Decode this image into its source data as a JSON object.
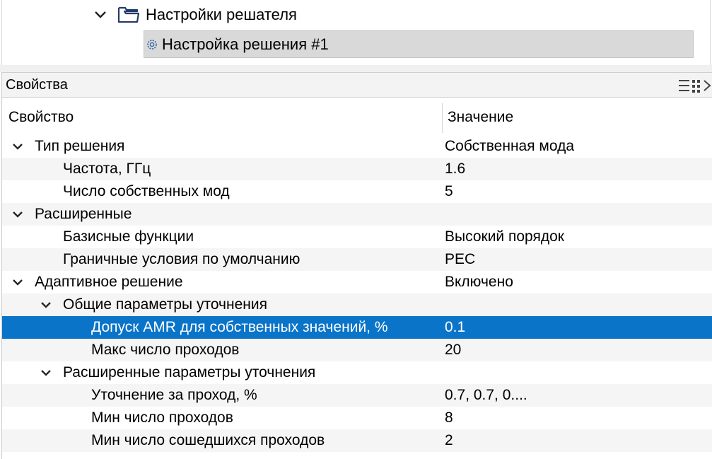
{
  "tree": {
    "folder_label": "Настройки решателя",
    "selected_label": "Настройка решения #1"
  },
  "properties_panel": {
    "title": "Свойства",
    "col_property": "Свойство",
    "col_value": "Значение",
    "rows": [
      {
        "name": "Тип решения",
        "value": "Собственная мода",
        "level": 0,
        "expandable": true
      },
      {
        "name": "Частота, ГГц",
        "value": "1.6",
        "level": 1,
        "expandable": false
      },
      {
        "name": "Число собственных мод",
        "value": "5",
        "level": 1,
        "expandable": false
      },
      {
        "name": "Расширенные",
        "value": "",
        "level": 0,
        "expandable": true
      },
      {
        "name": "Базисные функции",
        "value": "Высокий порядок",
        "level": 1,
        "expandable": false
      },
      {
        "name": "Граничные условия по умолчанию",
        "value": "PEC",
        "level": 1,
        "expandable": false
      },
      {
        "name": "Адаптивное решение",
        "value": "Включено",
        "level": 0,
        "expandable": true
      },
      {
        "name": "Общие параметры уточнения",
        "value": "",
        "level": 1,
        "expandable": true
      },
      {
        "name": "Допуск AMR для собственных значений, %",
        "value": "0.1",
        "level": 2,
        "expandable": false,
        "selected": true
      },
      {
        "name": "Макс число проходов",
        "value": "20",
        "level": 2,
        "expandable": false
      },
      {
        "name": "Расширенные параметры уточнения",
        "value": "",
        "level": 1,
        "expandable": true
      },
      {
        "name": "Уточнение за проход, %",
        "value": "0.7, 0.7, 0....",
        "level": 2,
        "expandable": false
      },
      {
        "name": "Мин число проходов",
        "value": "8",
        "level": 2,
        "expandable": false
      },
      {
        "name": "Мин число сошедшихся проходов",
        "value": "2",
        "level": 2,
        "expandable": false
      }
    ]
  },
  "colors": {
    "selection": "#0a74c9",
    "tree_selection": "#d9d9d9",
    "alt_row": "#f5f5f5"
  }
}
